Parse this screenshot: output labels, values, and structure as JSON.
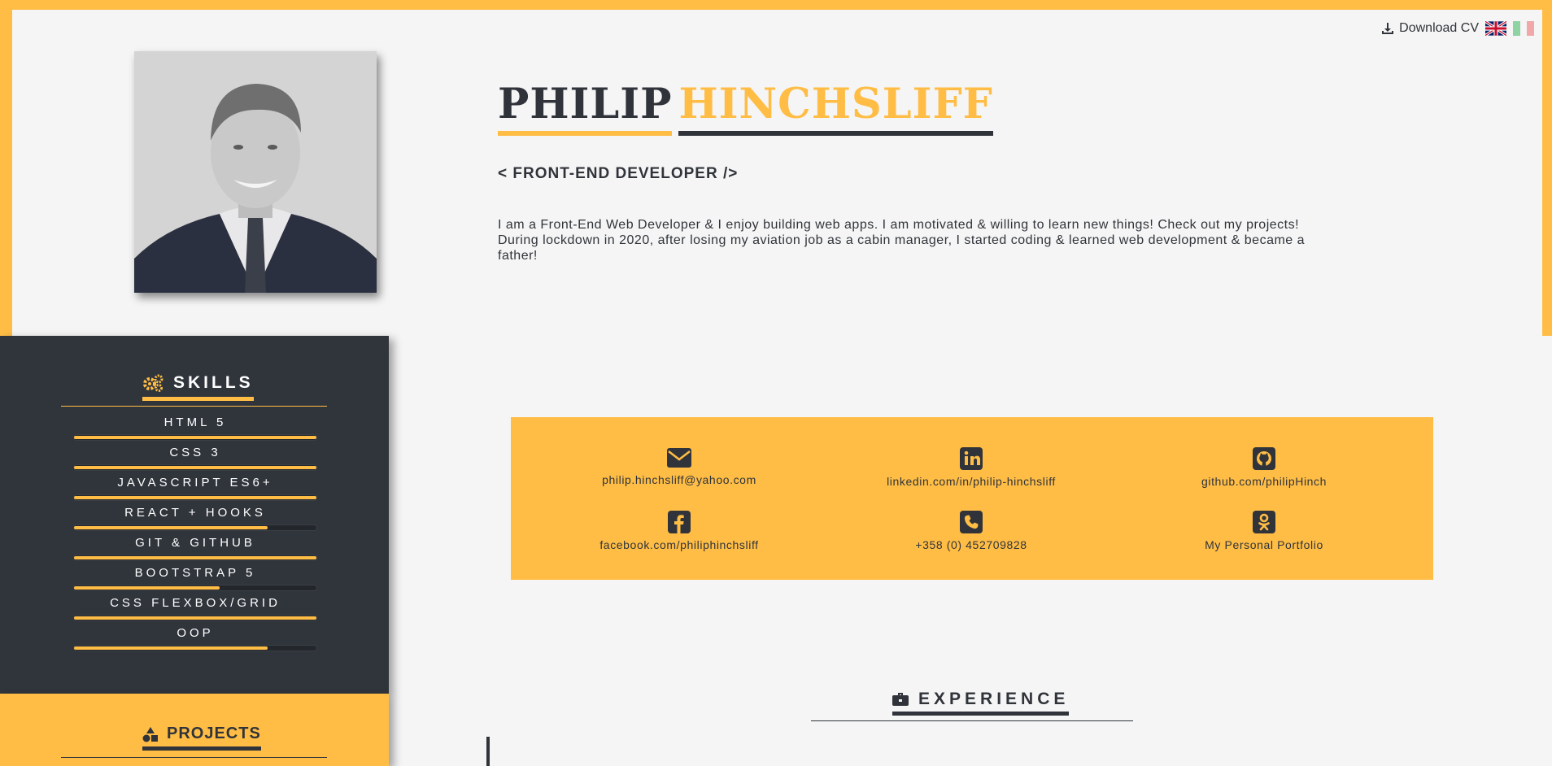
{
  "header": {
    "download_label": "Download CV",
    "languages": [
      "English",
      "Italian"
    ]
  },
  "profile": {
    "first_name": "PHILIP",
    "last_name": "HINCHSLIFF",
    "role": "< FRONT-END DEVELOPER />",
    "bio_line_1": "I am a Front-End Web Developer & I enjoy building web apps. I am motivated & willing to learn new things! Check out my projects!",
    "bio_line_2": "During lockdown in 2020, after losing my aviation job as a cabin manager, I started coding & learned web development & became a father!"
  },
  "skills": {
    "title": "SKILLS",
    "items": [
      {
        "label": "HTML 5",
        "level": 1.0
      },
      {
        "label": "CSS 3",
        "level": 1.0
      },
      {
        "label": "JAVASCRIPT ES6+",
        "level": 1.0
      },
      {
        "label": "REACT + HOOKS",
        "level": 0.8
      },
      {
        "label": "GIT & GITHUB",
        "level": 1.0
      },
      {
        "label": "BOOTSTRAP 5",
        "level": 0.6
      },
      {
        "label": "CSS FLEXBOX/GRID",
        "level": 1.0
      },
      {
        "label": "OOP",
        "level": 0.8
      }
    ]
  },
  "projects": {
    "title": "PROJECTS"
  },
  "contact": {
    "email": "philip.hinchsliff@yahoo.com",
    "linkedin": "linkedin.com/in/philip-hinchsliff",
    "github": "github.com/philipHinch",
    "facebook": "facebook.com/philiphinchsliff",
    "phone": "+358 (0) 452709828",
    "portfolio": "My Personal Portfolio"
  },
  "experience": {
    "title": "EXPERIENCE"
  },
  "colors": {
    "accent": "#ffbd45",
    "dark": "#30353c",
    "background": "#f5f5f5"
  }
}
